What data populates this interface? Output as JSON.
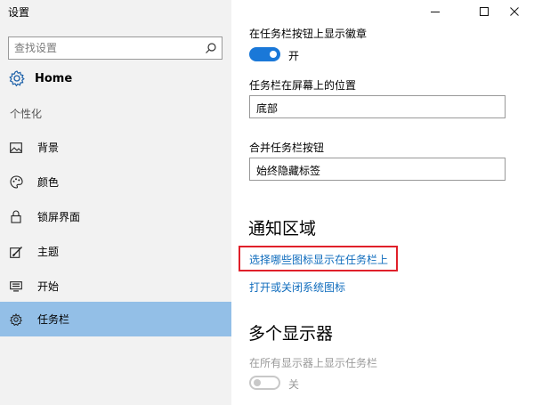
{
  "app": {
    "title": "设置"
  },
  "search": {
    "placeholder": "查找设置"
  },
  "sidebar": {
    "home_label": "Home",
    "section_label": "个性化",
    "items": [
      {
        "label": "背景",
        "icon": "picture-icon"
      },
      {
        "label": "颜色",
        "icon": "palette-icon"
      },
      {
        "label": "锁屏界面",
        "icon": "lock-icon"
      },
      {
        "label": "主题",
        "icon": "brush-icon"
      },
      {
        "label": "开始",
        "icon": "start-menu-icon"
      },
      {
        "label": "任务栏",
        "icon": "taskbar-icon",
        "selected": true
      }
    ]
  },
  "main": {
    "badges_label": "在任务栏按钮上显示徽章",
    "badges_toggle_state": "开",
    "position_label": "任务栏在屏幕上的位置",
    "position_value": "底部",
    "combine_label": "合并任务栏按钮",
    "combine_value": "始终隐藏标签",
    "notification_heading": "通知区域",
    "link_select_icons": "选择哪些图标显示在任务栏上",
    "link_system_icons": "打开或关闭系统图标",
    "multi_display_heading": "多个显示器",
    "show_on_all_label": "在所有显示器上显示任务栏",
    "show_on_all_toggle_state": "关"
  },
  "colors": {
    "accent": "#1a78d8",
    "selection": "#93bfe7",
    "link": "#0f6cbd",
    "highlight": "#e0202a"
  }
}
